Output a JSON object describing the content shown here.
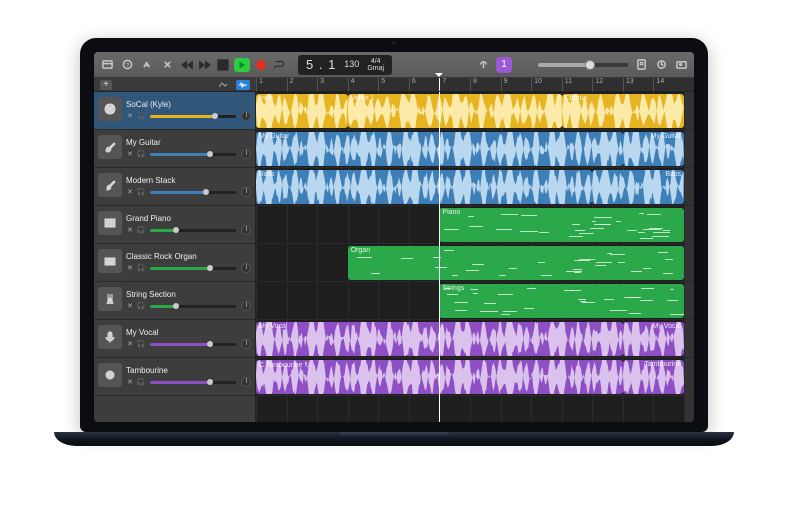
{
  "toolbar": {
    "position": "5 . 1",
    "tempo": "130",
    "time_sig": "4/4",
    "key": "Gmaj",
    "count_in": "1"
  },
  "ruler": {
    "start": 1,
    "end": 15,
    "playhead_bar": 7.0
  },
  "tracks": [
    {
      "name": "SoCal (Kyle)",
      "icon": "drums",
      "color": "#e6b321",
      "selected": true,
      "vol": 0.75
    },
    {
      "name": "My Guitar",
      "icon": "guitar",
      "color": "#3f7fb8",
      "selected": false,
      "vol": 0.7
    },
    {
      "name": "Modern Stack",
      "icon": "bass",
      "color": "#3f7fb8",
      "selected": false,
      "vol": 0.65
    },
    {
      "name": "Grand Piano",
      "icon": "piano",
      "color": "#2ba84a",
      "selected": false,
      "vol": 0.3
    },
    {
      "name": "Classic Rock Organ",
      "icon": "organ",
      "color": "#2ba84a",
      "selected": false,
      "vol": 0.7
    },
    {
      "name": "String Section",
      "icon": "strings",
      "color": "#2ba84a",
      "selected": false,
      "vol": 0.3
    },
    {
      "name": "My Vocal",
      "icon": "mic",
      "color": "#8e4fc4",
      "selected": false,
      "vol": 0.7
    },
    {
      "name": "Tambourine",
      "icon": "tamb",
      "color": "#8e4fc4",
      "selected": false,
      "vol": 0.7
    }
  ],
  "regions": [
    {
      "track": 0,
      "label": "Intro",
      "start": 1,
      "end": 4,
      "color": "yellow",
      "wave": true
    },
    {
      "track": 0,
      "label": "Verse 1",
      "start": 4,
      "end": 11,
      "color": "yellow",
      "wave": true
    },
    {
      "track": 0,
      "label": "Chorus",
      "start": 11,
      "end": 15,
      "color": "yellow",
      "wave": true
    },
    {
      "track": 1,
      "label": "My Guitar",
      "start": 1,
      "end": 13,
      "color": "blue",
      "wave": true
    },
    {
      "track": 1,
      "label": "My Guitar",
      "label_right": true,
      "start": 13,
      "end": 15,
      "color": "blue",
      "wave": true
    },
    {
      "track": 2,
      "label": "Bass",
      "start": 1,
      "end": 12,
      "color": "blue",
      "wave": true
    },
    {
      "track": 2,
      "label": "Bass",
      "label_right": true,
      "start": 12,
      "end": 15,
      "color": "blue",
      "wave": true
    },
    {
      "track": 3,
      "label": "Piano",
      "start": 7,
      "end": 15,
      "color": "green",
      "midi": true
    },
    {
      "track": 4,
      "label": "Organ",
      "start": 4,
      "end": 15,
      "color": "green",
      "midi": true
    },
    {
      "track": 5,
      "label": "Strings",
      "start": 7,
      "end": 15,
      "color": "green",
      "midi": true
    },
    {
      "track": 6,
      "label": "My Vocal",
      "start": 1,
      "end": 13,
      "color": "purple",
      "wave": true
    },
    {
      "track": 6,
      "label": "My Vocal",
      "label_right": true,
      "start": 13,
      "end": 15,
      "color": "purple",
      "wave": true
    },
    {
      "track": 7,
      "label": "C Tambourine  ↻",
      "start": 1,
      "end": 13,
      "color": "purple",
      "wave": true
    },
    {
      "track": 7,
      "label": "Tambourine",
      "label_right": true,
      "start": 13,
      "end": 15,
      "color": "purple",
      "wave": true
    }
  ]
}
